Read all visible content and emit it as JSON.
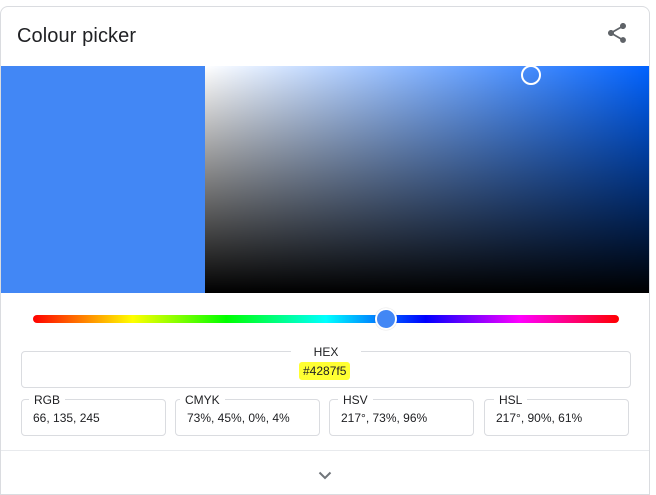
{
  "widget": {
    "title": "Colour picker",
    "share_icon": "share-icon",
    "expand_icon": "chevron-down-icon"
  },
  "color": {
    "preview_hex": "#4287f5",
    "hue_hex": "#0062ff",
    "hue_fraction": 0.603,
    "saturation": 0.73,
    "value": 0.96
  },
  "hex": {
    "label": "HEX",
    "value": "#4287f5",
    "highlight_color": "#ffff33"
  },
  "fields": [
    {
      "label": "RGB",
      "value": "66, 135, 245"
    },
    {
      "label": "CMYK",
      "value": "73%, 45%, 0%, 4%"
    },
    {
      "label": "HSV",
      "value": "217°, 73%, 96%"
    },
    {
      "label": "HSL",
      "value": "217°, 90%, 61%"
    }
  ]
}
